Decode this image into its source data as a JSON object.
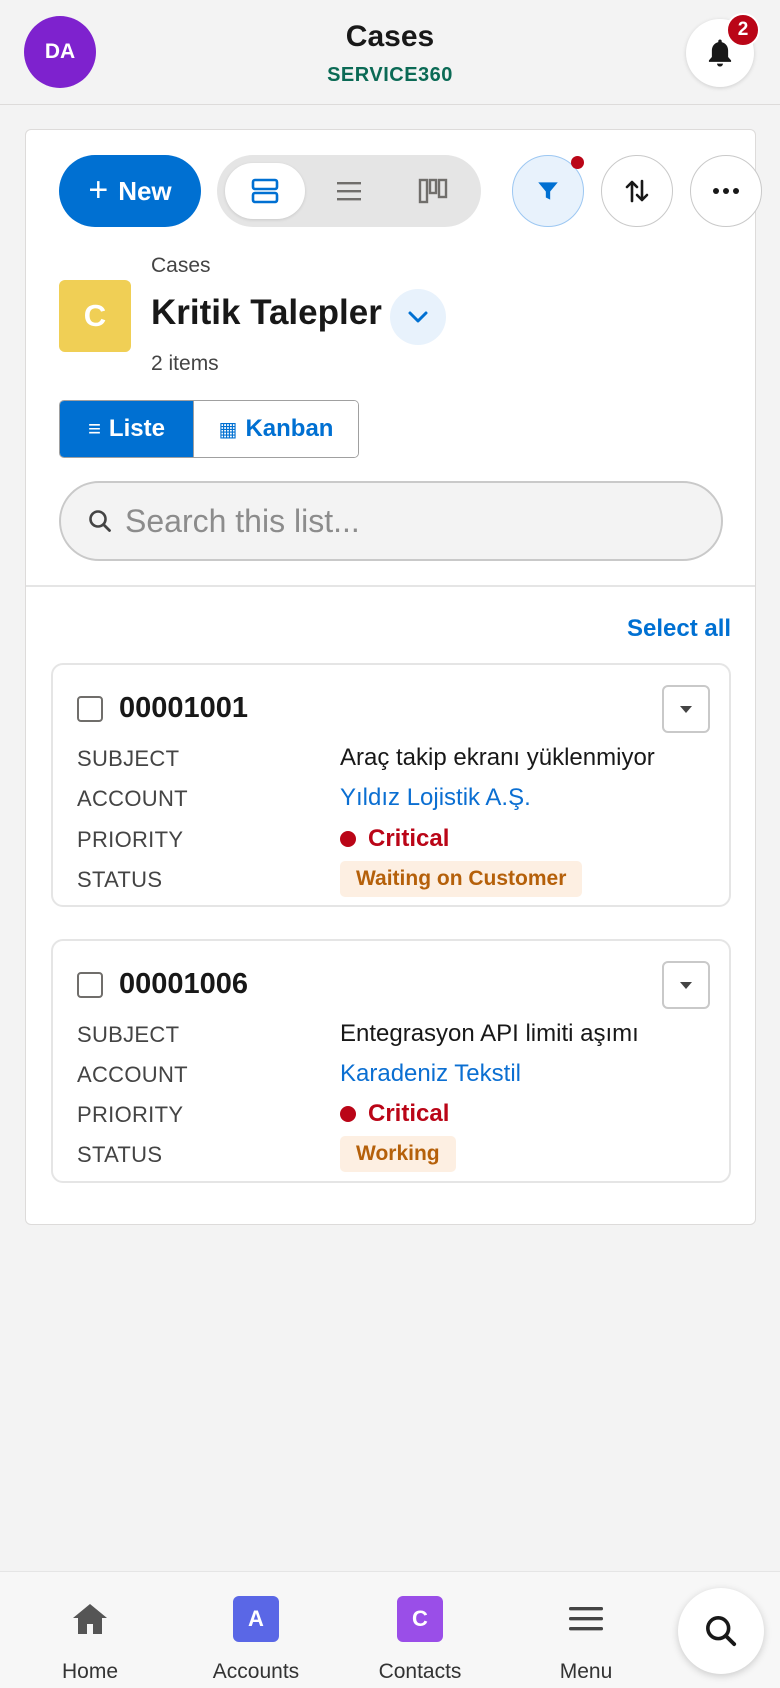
{
  "header": {
    "avatar_initials": "DA",
    "title": "Cases",
    "subtitle": "SERVICE360",
    "notification_count": "2",
    "avatar_color": "#7e22ce",
    "subtitle_color": "#0b6a55"
  },
  "toolbar": {
    "new_label": "New",
    "view_modes": [
      "compact-view-icon",
      "list-view-icon",
      "kanban-view-icon"
    ],
    "active_view": 0,
    "filter_active": true
  },
  "list_header": {
    "object_label": "Cases",
    "object_icon_letter": "C",
    "list_name": "Kritik Talepler",
    "item_count": "2 items"
  },
  "segmented": {
    "list_label": "Liste",
    "kanban_label": "Kanban",
    "active": "list"
  },
  "search": {
    "placeholder": "Search this list..."
  },
  "select_all_label": "Select all",
  "field_labels": {
    "subject": "SUBJECT",
    "account": "ACCOUNT",
    "priority": "PRIORITY",
    "status": "STATUS"
  },
  "cases": [
    {
      "number": "00001001",
      "subject": "Araç takip ekranı yüklenmiyor",
      "account": "Yıldız Lojistik A.Ş.",
      "priority": "Critical",
      "status": "Waiting on Customer"
    },
    {
      "number": "00001006",
      "subject": "Entegrasyon API limiti aşımı",
      "account": "Karadeniz Tekstil",
      "priority": "Critical",
      "status": "Working"
    }
  ],
  "bottom_nav": {
    "items": [
      {
        "label": "Home",
        "icon": "home-icon"
      },
      {
        "label": "Accounts",
        "icon": "A",
        "color": "#5a67e6"
      },
      {
        "label": "Contacts",
        "icon": "C",
        "color": "#9a4ee8"
      },
      {
        "label": "Menu",
        "icon": "menu-icon"
      }
    ]
  },
  "colors": {
    "brand_blue": "#0070d2",
    "critical_red": "#ba0517",
    "status_orange": "#b5600a"
  }
}
